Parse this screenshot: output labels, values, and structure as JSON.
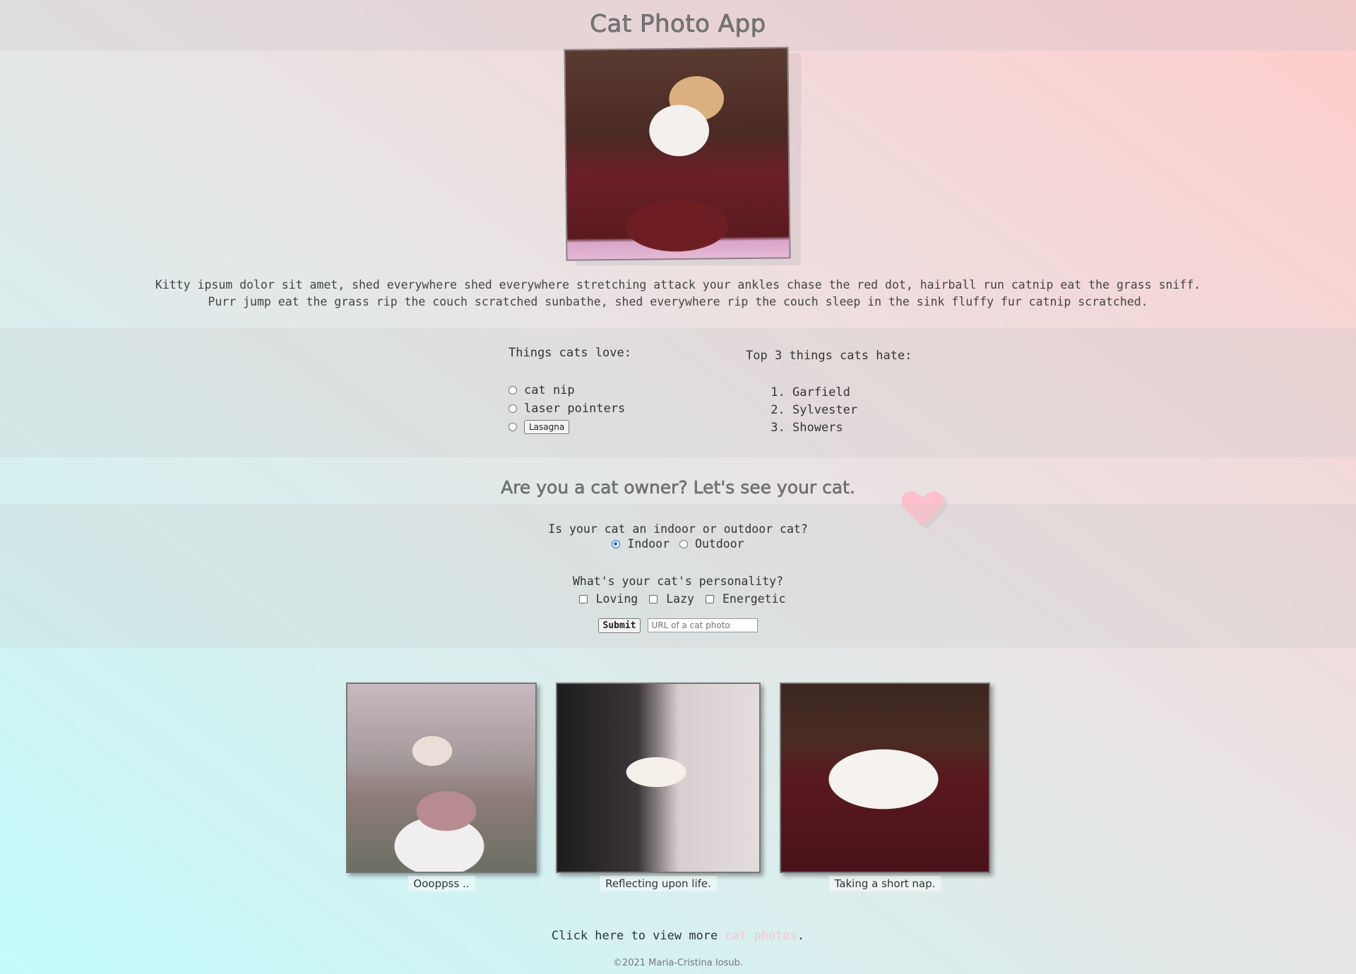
{
  "header": {
    "title": "Cat Photo App"
  },
  "intro": {
    "line1": "Kitty ipsum dolor sit amet, shed everywhere shed everywhere stretching attack your ankles chase the red dot, hairball run catnip eat the grass sniff.",
    "line2": "Purr jump eat the grass rip the couch scratched sunbathe, shed everywhere rip the couch sleep in the sink fluffy fur catnip scratched."
  },
  "love": {
    "heading": "Things cats love:",
    "items": [
      "cat nip",
      "laser pointers",
      "Lasagna"
    ]
  },
  "hate": {
    "heading": "Top 3 things cats hate:",
    "items": [
      "Garfield",
      "Sylvester",
      "Showers"
    ]
  },
  "owner": {
    "heading": "Are you a cat owner? Let's see your cat.",
    "question1": "Is your cat an indoor or outdoor cat?",
    "indoor_label": "Indoor",
    "outdoor_label": "Outdoor",
    "selected": "Indoor",
    "question2": "What's your cat's personality?",
    "personality": [
      "Loving",
      "Lazy",
      "Energetic"
    ],
    "submit_label": "Submit",
    "url_placeholder": "URL of a cat photo"
  },
  "gallery": {
    "captions": [
      "Oooppss ..",
      "Reflecting upon life.",
      "Taking a short nap."
    ]
  },
  "more": {
    "prefix": "Click here to view more ",
    "link": "cat photos",
    "suffix": "."
  },
  "footer": {
    "text": "©2021 Maria-Cristina Iosub."
  },
  "colors": {
    "link": "#ffc0cb",
    "radio_selected": "#1a66d6",
    "heart": "#ffc0cb"
  }
}
